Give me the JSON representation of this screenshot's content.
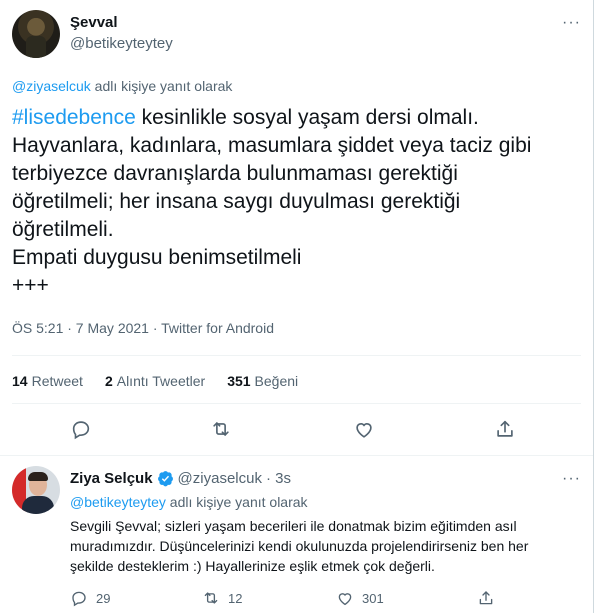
{
  "main_tweet": {
    "author_name": "Şevval",
    "author_handle": "@betikeyteytey",
    "reply_prefix_mention": "@ziyaselcuk",
    "reply_prefix_rest": " adlı kişiye yanıt olarak",
    "hashtag": "#lisedebence",
    "text_line1_rest": " kesinlikle sosyal yaşam dersi olmalı.",
    "text_line2": "Hayvanlara, kadınlara, masumlara şiddet veya taciz gibi",
    "text_line3": "terbiyezce davranışlarda bulunmaması gerektiği",
    "text_line4": "öğretilmeli; her insana saygı duyulması gerektiği",
    "text_line5": "öğretilmeli.",
    "text_line6": "Empati duygusu benimsetilmeli",
    "text_line7": "+++",
    "timestamp": "ÖS 5:21 · 7 May 2021 · Twitter for Android",
    "stats": {
      "retweets_count": "14",
      "retweets_label": "Retweet",
      "quotes_count": "2",
      "quotes_label": "Alıntı Tweetler",
      "likes_count": "351",
      "likes_label": "Beğeni"
    }
  },
  "reply_tweet": {
    "author_name": "Ziya Selçuk",
    "author_handle": "@ziyaselcuk",
    "time_ago": "· 3s",
    "reply_prefix_mention": "@betikeyteytey",
    "reply_prefix_rest": " adlı kişiye yanıt olarak",
    "text_line1": "Sevgili Şevval; sizleri yaşam becerileri ile donatmak bizim eğitimden asıl",
    "text_line2": "muradımızdır. Düşüncelerinizi kendi okulunuzda projelendirirseniz ben her",
    "text_line3": "şekilde desteklerim :) Hayallerinize eşlik etmek çok değerli.",
    "reply_count": "29",
    "retweet_count": "12",
    "like_count": "301"
  },
  "icons": [
    "more-icon",
    "reply-icon",
    "retweet-icon",
    "like-icon",
    "share-icon",
    "verified-icon"
  ],
  "colors": {
    "accent": "#1d9bf0",
    "secondary_text": "#536471",
    "text": "#0f1419"
  }
}
